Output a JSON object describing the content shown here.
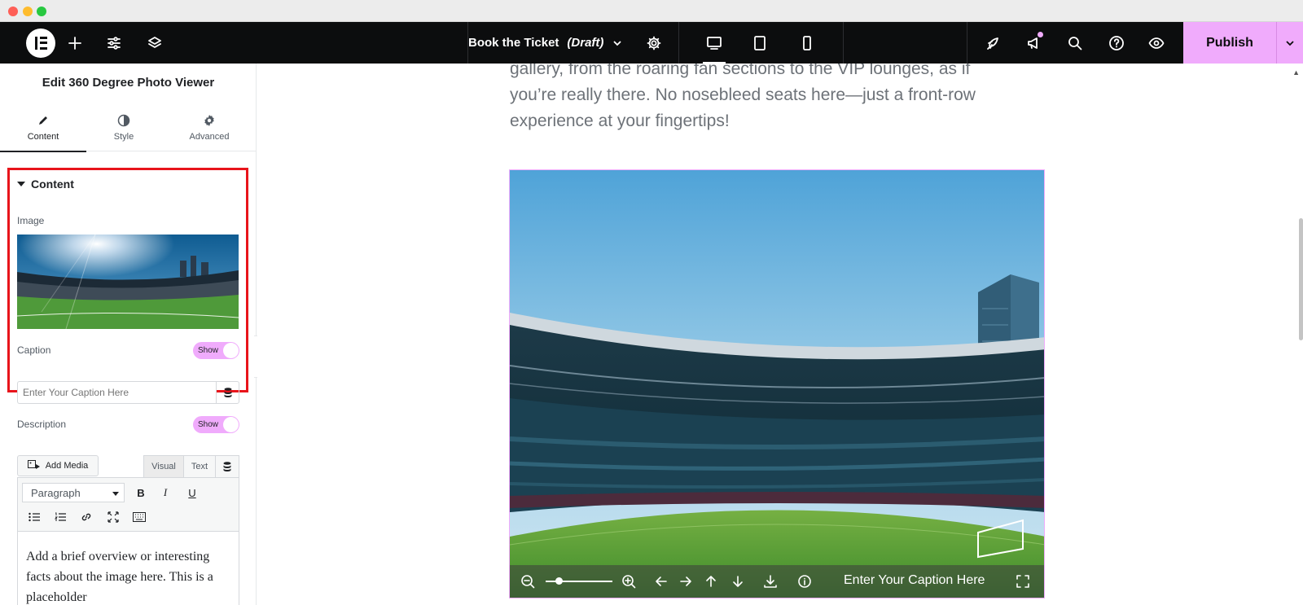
{
  "topbar": {
    "page_title": "Book the Ticket",
    "page_status": "(Draft)",
    "publish_label": "Publish"
  },
  "panel": {
    "title": "Edit 360 Degree Photo Viewer",
    "tabs": [
      {
        "label": "Content",
        "icon": "pencil-icon"
      },
      {
        "label": "Style",
        "icon": "half-circle-icon"
      },
      {
        "label": "Advanced",
        "icon": "gear-icon"
      }
    ],
    "section_label": "Content",
    "image_label": "Image",
    "caption_label": "Caption",
    "caption_toggle": "Show",
    "caption_placeholder": "Enter Your Caption Here",
    "description_label": "Description",
    "description_toggle": "Show",
    "add_media_label": "Add Media",
    "editor_tab_visual": "Visual",
    "editor_tab_text": "Text",
    "format_select": "Paragraph",
    "editor_content": "Add a brief overview or interesting facts about the image here. This is a placeholder"
  },
  "canvas": {
    "body_text": "gallery, from the roaring fan sections to the VIP lounges, as if you’re really there. No nosebleed seats here—just a front-row experience at your fingertips!",
    "viewer_caption": "Enter Your Caption Here"
  },
  "colors": {
    "accent": "#f0abfc",
    "topbar": "#0c0d0e",
    "highlight_box": "#e8141b"
  }
}
